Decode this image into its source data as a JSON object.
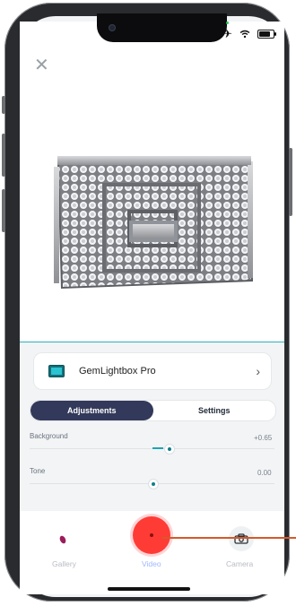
{
  "status": {
    "airplane_icon": "airplane-icon",
    "wifi_icon": "wifi-icon",
    "battery_icon": "battery-icon"
  },
  "close_label": "✕",
  "device": {
    "name": "GemLightbox Pro"
  },
  "tabs": [
    {
      "label": "Adjustments",
      "active": true
    },
    {
      "label": "Settings",
      "active": false
    }
  ],
  "sliders": [
    {
      "label": "Background",
      "value_text": "+0.65",
      "level": 0.65
    },
    {
      "label": "Tone",
      "value_text": "0.00",
      "level": 0.0
    }
  ],
  "bottom_nav": {
    "gallery": "Gallery",
    "video": "Video",
    "camera": "Camera"
  },
  "colors": {
    "accent": "#18a6b3",
    "record": "#ff3b35",
    "tab_active": "#33395a",
    "pointer": "#d45a2a"
  }
}
